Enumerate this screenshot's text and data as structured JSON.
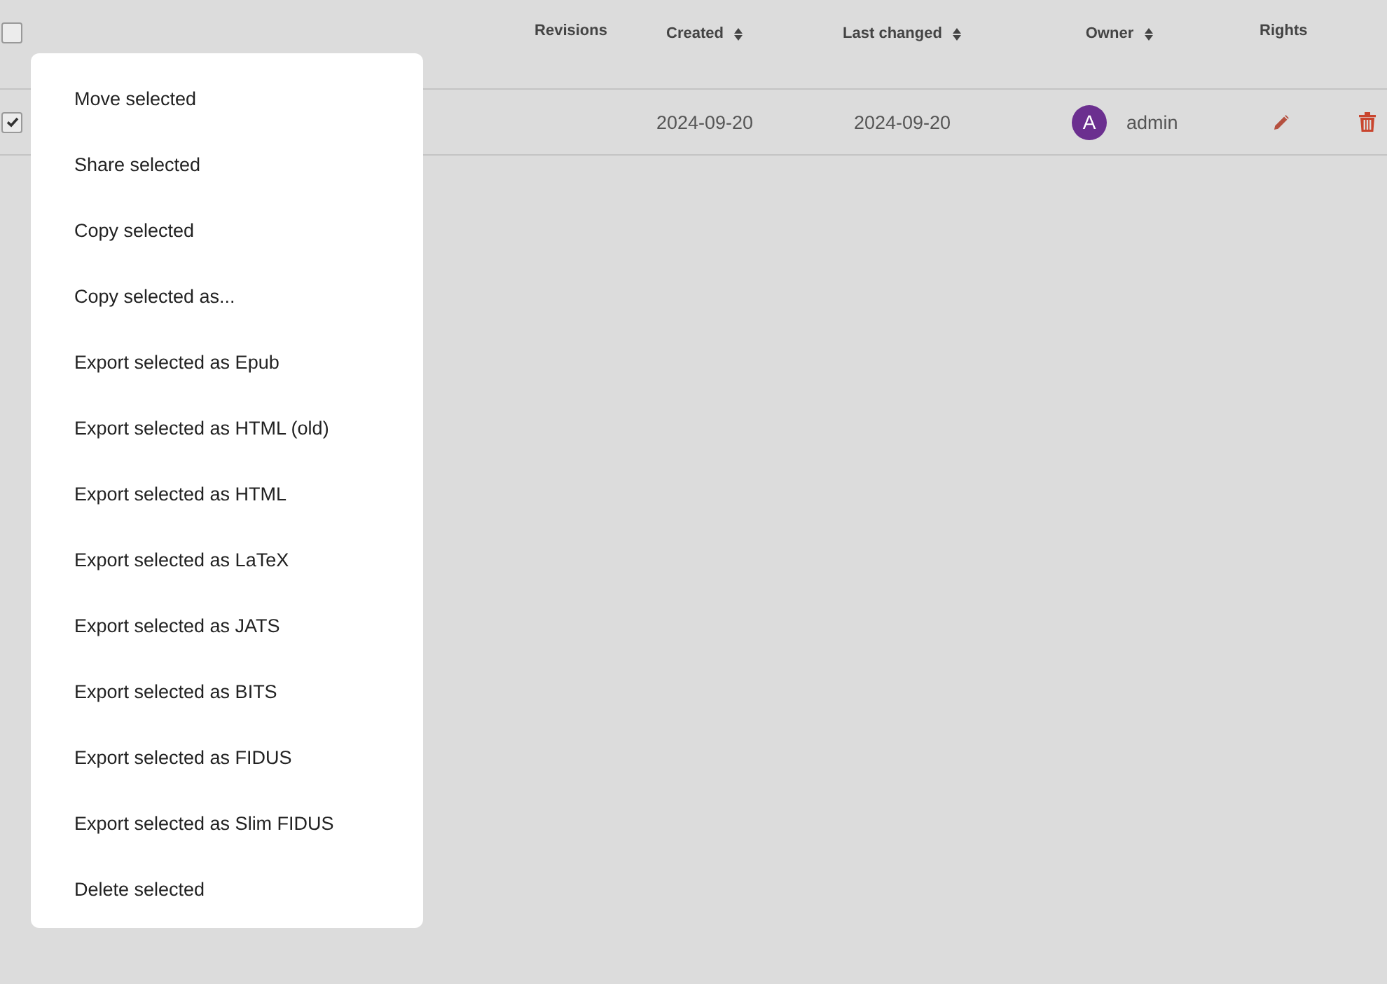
{
  "table": {
    "header_checkbox": {
      "checked": false
    },
    "columns": [
      {
        "label": "Revisions",
        "sortable": false
      },
      {
        "label": "Created",
        "sortable": true
      },
      {
        "label": "Last changed",
        "sortable": true
      },
      {
        "label": "Owner",
        "sortable": true
      },
      {
        "label": "Rights",
        "sortable": false
      }
    ],
    "rows": [
      {
        "checked": true,
        "created": "2024-09-20",
        "last_changed": "2024-09-20",
        "owner": {
          "initial": "A",
          "name": "admin",
          "color": "#6b2f8f"
        }
      }
    ]
  },
  "context_menu": {
    "items": [
      "Move selected",
      "Share selected",
      "Copy selected",
      "Copy selected as...",
      "Export selected as Epub",
      "Export selected as HTML (old)",
      "Export selected as HTML",
      "Export selected as LaTeX",
      "Export selected as JATS",
      "Export selected as BITS",
      "Export selected as FIDUS",
      "Export selected as Slim FIDUS",
      "Delete selected"
    ]
  }
}
